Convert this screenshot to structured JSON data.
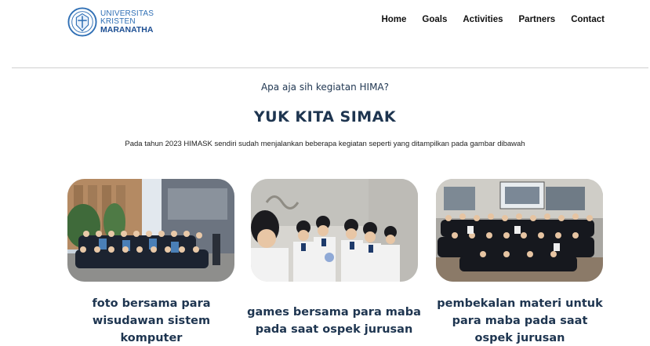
{
  "logo": {
    "line1": "UNIVERSITAS",
    "line2": "KRISTEN",
    "line3": "MARANATHA"
  },
  "nav": [
    "Home",
    "Goals",
    "Activities",
    "Partners",
    "Contact"
  ],
  "hero": {
    "kicker": "Apa aja sih kegiatan HIMA?",
    "title": "YUK KITA SIMAK",
    "description": "Pada tahun 2023 HIMASK sendiri sudah menjalankan beberapa kegiatan seperti yang ditampilkan pada gambar dibawah"
  },
  "cards": [
    {
      "caption_lines": [
        "foto bersama para",
        "wisudawan sistem",
        "komputer"
      ]
    },
    {
      "caption_lines": [
        "games bersama para maba",
        "pada saat ospek jurusan"
      ]
    },
    {
      "caption_lines": [
        "pembekalan materi untuk",
        "para maba pada saat",
        "ospek jurusan"
      ]
    }
  ]
}
